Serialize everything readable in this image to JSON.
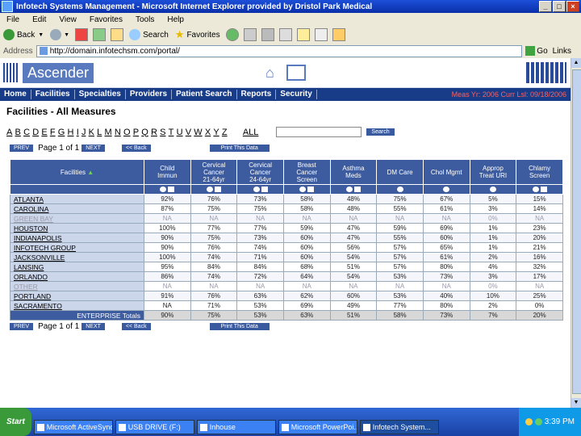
{
  "window": {
    "title": "Infotech Systems Management - Microsoft Internet Explorer provided by Dristol Park Medical"
  },
  "menu": [
    "File",
    "Edit",
    "View",
    "Favorites",
    "Tools",
    "Help"
  ],
  "toolbar": {
    "back": "Back",
    "search": "Search",
    "favorites": "Favorites"
  },
  "address": {
    "label": "Address",
    "url": "http://domain.infotechsm.com/portal/",
    "go": "Go",
    "links": "Links"
  },
  "header": {
    "logo_text": "Ascender"
  },
  "nav": {
    "items": [
      "Home",
      "Facilities",
      "Specialties",
      "Providers",
      "Patient Search",
      "Reports",
      "Security"
    ],
    "right_text": "Meas Yr: 2006  Curr Lsl: 09/18/2006"
  },
  "page": {
    "title": "Facilities - All Measures",
    "letters": [
      "A",
      "B",
      "C",
      "D",
      "E",
      "F",
      "G",
      "H",
      "I",
      "J",
      "K",
      "L",
      "M",
      "N",
      "O",
      "P",
      "Q",
      "R",
      "S",
      "T",
      "U",
      "V",
      "W",
      "X",
      "Y",
      "Z"
    ],
    "all_label": "ALL",
    "search_button": "Search",
    "prev_label": "PREV",
    "page_info": "Page 1 of 1",
    "next_label": "NEXT",
    "back_label": "<< Back",
    "print_label": "Print This Data"
  },
  "table": {
    "facility_header": "Facilities",
    "columns": [
      "Child\nImmun",
      "Cervical\nCancer\n21-64yr",
      "Cervical\nCancer\n24-64yr",
      "Breast\nCancer\nScreen",
      "Asthma\nMeds",
      "DM Care",
      "Chol Mgmt",
      "Approp\nTreat URI",
      "Chlamy\nScreen"
    ],
    "rows": [
      {
        "name": "ATLANTA",
        "values": [
          "92%",
          "76%",
          "73%",
          "58%",
          "48%",
          "75%",
          "67%",
          "5%",
          "15%"
        ],
        "na": false
      },
      {
        "name": "CAROLINA",
        "values": [
          "87%",
          "75%",
          "75%",
          "58%",
          "48%",
          "55%",
          "61%",
          "3%",
          "14%"
        ],
        "na": false
      },
      {
        "name": "GREEN BAY",
        "values": [
          "NA",
          "NA",
          "NA",
          "NA",
          "NA",
          "NA",
          "NA",
          "0%",
          "NA"
        ],
        "na": true
      },
      {
        "name": "HOUSTON",
        "values": [
          "100%",
          "77%",
          "77%",
          "59%",
          "47%",
          "59%",
          "69%",
          "1%",
          "23%"
        ],
        "na": false
      },
      {
        "name": "INDIANAPOLIS",
        "values": [
          "90%",
          "75%",
          "73%",
          "60%",
          "47%",
          "55%",
          "60%",
          "1%",
          "20%"
        ],
        "na": false
      },
      {
        "name": "INFOTECH GROUP",
        "values": [
          "90%",
          "76%",
          "74%",
          "60%",
          "56%",
          "57%",
          "65%",
          "1%",
          "21%"
        ],
        "na": false
      },
      {
        "name": "JACKSONVILLE",
        "values": [
          "100%",
          "74%",
          "71%",
          "60%",
          "54%",
          "57%",
          "61%",
          "2%",
          "16%"
        ],
        "na": false
      },
      {
        "name": "LANSING",
        "values": [
          "95%",
          "84%",
          "84%",
          "68%",
          "51%",
          "57%",
          "80%",
          "4%",
          "32%"
        ],
        "na": false
      },
      {
        "name": "ORLANDO",
        "values": [
          "86%",
          "74%",
          "72%",
          "64%",
          "54%",
          "53%",
          "73%",
          "3%",
          "17%"
        ],
        "na": false
      },
      {
        "name": "OTHER",
        "values": [
          "NA",
          "NA",
          "NA",
          "NA",
          "NA",
          "NA",
          "NA",
          "0%",
          "NA"
        ],
        "na": true
      },
      {
        "name": "PORTLAND",
        "values": [
          "91%",
          "76%",
          "63%",
          "62%",
          "60%",
          "53%",
          "40%",
          "10%",
          "25%"
        ],
        "na": false
      },
      {
        "name": "SACRAMENTO",
        "values": [
          "NA",
          "71%",
          "53%",
          "69%",
          "49%",
          "77%",
          "80%",
          "2%",
          "0%"
        ],
        "na": false
      }
    ],
    "total": {
      "name": "ENTERPRISE Totals",
      "values": [
        "90%",
        "75%",
        "53%",
        "63%",
        "51%",
        "58%",
        "73%",
        "7%",
        "20%"
      ]
    }
  },
  "taskbar": {
    "start": "Start",
    "tasks": [
      "Microsoft ActiveSync",
      "USB DRIVE (F:)",
      "Inhouse",
      "Microsoft PowerPoi...",
      "Infotech System..."
    ],
    "time": "3:39 PM"
  }
}
